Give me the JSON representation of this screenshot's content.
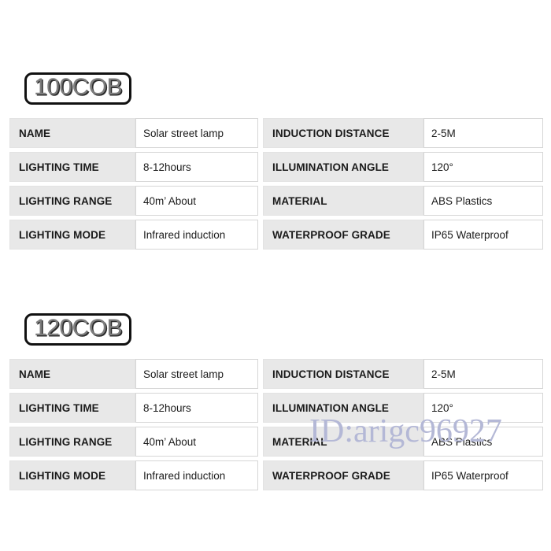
{
  "page": {
    "background_color": "#ffffff",
    "label_cell_color": "#e8e8e8",
    "value_cell_color": "#ffffff",
    "badge_text_color": "#7d7d7d",
    "badge_border_color": "#111111",
    "watermark_color": "#b4b8d6"
  },
  "watermark": {
    "text": "ID:arigc96927"
  },
  "sections": [
    {
      "badge": "100COB",
      "left_rows": [
        {
          "label": "NAME",
          "value": "Solar street lamp"
        },
        {
          "label": "LIGHTING TIME",
          "value": "8-12hours"
        },
        {
          "label": "LIGHTING RANGE",
          "value": "40m’  About"
        },
        {
          "label": "LIGHTING MODE",
          "value": "Infrared induction"
        }
      ],
      "right_rows": [
        {
          "label": "INDUCTION DISTANCE",
          "value": "2-5M"
        },
        {
          "label": "ILLUMINATION ANGLE",
          "value": "120°"
        },
        {
          "label": "MATERIAL",
          "value": "ABS Plastics"
        },
        {
          "label": "WATERPROOF GRADE",
          "value": "IP65 Waterproof"
        }
      ]
    },
    {
      "badge": "120COB",
      "left_rows": [
        {
          "label": "NAME",
          "value": "Solar street lamp"
        },
        {
          "label": "LIGHTING TIME",
          "value": "8-12hours"
        },
        {
          "label": "LIGHTING RANGE",
          "value": "40m’  About"
        },
        {
          "label": "LIGHTING MODE",
          "value": "Infrared induction"
        }
      ],
      "right_rows": [
        {
          "label": "INDUCTION DISTANCE",
          "value": "2-5M"
        },
        {
          "label": "ILLUMINATION ANGLE",
          "value": "120°"
        },
        {
          "label": "MATERIAL",
          "value": "ABS Plastics"
        },
        {
          "label": "WATERPROOF GRADE",
          "value": "IP65 Waterproof"
        }
      ]
    }
  ]
}
